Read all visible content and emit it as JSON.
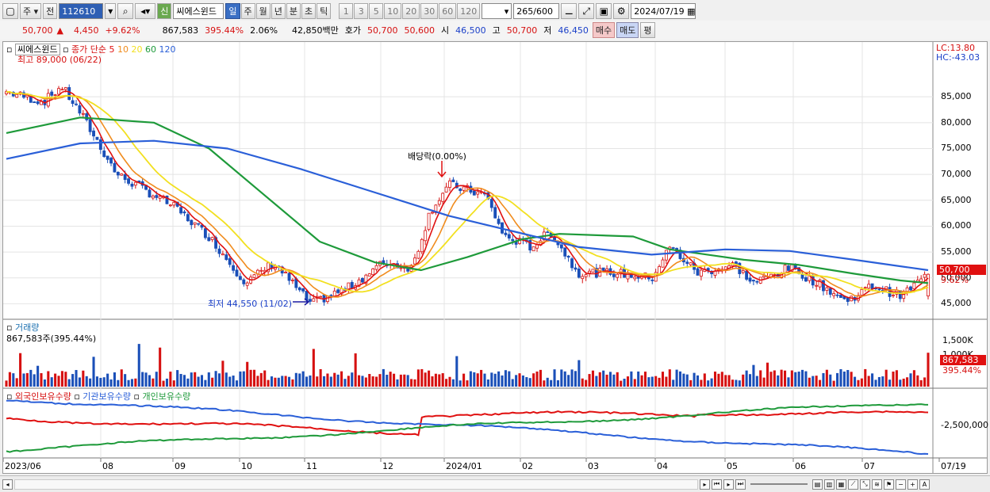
{
  "toolbar": {
    "period_type": "주",
    "prev_label": "전",
    "stock_code": "112610",
    "new_label": "신",
    "stock_name": "씨에스윈드",
    "timeframes": [
      "일",
      "주",
      "월",
      "년",
      "분",
      "초",
      "틱"
    ],
    "selected_timeframe": "일",
    "intervals": [
      "1",
      "3",
      "5",
      "10",
      "20",
      "30",
      "60",
      "120"
    ],
    "count": "265",
    "count_total": "/600",
    "date": "2024/07/19"
  },
  "quote": {
    "price": "50,700",
    "change": "4,450",
    "change_pct": "+9.62%",
    "volume": "867,583",
    "volume_ratio": "395.44%",
    "turnover_pct": "2.06%",
    "amount": "42,850백만",
    "ask_label": "호가",
    "ask": "50,700",
    "bid": "50,600",
    "open_label": "시",
    "open": "46,500",
    "high_label": "고",
    "high": "50,700",
    "low_label": "저",
    "low": "46,450",
    "buy_label": "매수",
    "sell_label": "매도",
    "eval_label": "평"
  },
  "price_pane": {
    "legend_name": "씨에스윈드",
    "ma_title": "종가 단순",
    "ma_periods": [
      "5",
      "10",
      "20",
      "60",
      "120"
    ],
    "high_note": "최고 89,000 (06/22)",
    "low_note": "최저 44,550 (11/02)",
    "dividend_note": "배당락(0.00%)",
    "lc": "LC:13.80",
    "hc": "HC:-43.03",
    "y_ticks": [
      "85,000",
      "80,000",
      "75,000",
      "70,000",
      "65,000",
      "60,000",
      "55,000",
      "50,000",
      "45,000"
    ],
    "last_price": "50,700",
    "last_pct": "9.62%"
  },
  "volume_pane": {
    "title": "거래량",
    "value": "867,583주(395.44%)",
    "ticks": [
      "1,500K",
      "1,000K"
    ],
    "last": "867,583",
    "last_pct": "395.44%"
  },
  "holder_pane": {
    "legend": [
      "외국인보유수량",
      "기관보유수량",
      "개인보유수량"
    ],
    "tick": "-2,500,000"
  },
  "x_axis": [
    "2023/06",
    "08",
    "09",
    "10",
    "11",
    "12",
    "2024/01",
    "02",
    "03",
    "04",
    "05",
    "06",
    "07",
    "07/19"
  ],
  "colors": {
    "ma5": "#e01010",
    "ma10": "#f08c1e",
    "ma20": "#f2e020",
    "ma60": "#1e9a3a",
    "ma120": "#2a5fd8",
    "up": "#d61010",
    "down": "#1a4fb8"
  },
  "chart_data": {
    "type": "line",
    "y_range": [
      42000,
      91000
    ],
    "anchors": [
      {
        "x": 0.0,
        "close": 86000
      },
      {
        "x": 0.04,
        "close": 84000
      },
      {
        "x": 0.06,
        "close": 87000
      },
      {
        "x": 0.08,
        "close": 82000
      },
      {
        "x": 0.12,
        "close": 70000
      },
      {
        "x": 0.18,
        "close": 64000
      },
      {
        "x": 0.22,
        "close": 58000
      },
      {
        "x": 0.26,
        "close": 49000
      },
      {
        "x": 0.29,
        "close": 53000
      },
      {
        "x": 0.33,
        "close": 45000
      },
      {
        "x": 0.37,
        "close": 48000
      },
      {
        "x": 0.41,
        "close": 53000
      },
      {
        "x": 0.44,
        "close": 52000
      },
      {
        "x": 0.46,
        "close": 63000
      },
      {
        "x": 0.48,
        "close": 68000
      },
      {
        "x": 0.52,
        "close": 66000
      },
      {
        "x": 0.54,
        "close": 58000
      },
      {
        "x": 0.57,
        "close": 56000
      },
      {
        "x": 0.59,
        "close": 59000
      },
      {
        "x": 0.62,
        "close": 51000
      },
      {
        "x": 0.66,
        "close": 51000
      },
      {
        "x": 0.7,
        "close": 50000
      },
      {
        "x": 0.72,
        "close": 56000
      },
      {
        "x": 0.75,
        "close": 51000
      },
      {
        "x": 0.79,
        "close": 52500
      },
      {
        "x": 0.81,
        "close": 49000
      },
      {
        "x": 0.85,
        "close": 52000
      },
      {
        "x": 0.89,
        "close": 48000
      },
      {
        "x": 0.91,
        "close": 45500
      },
      {
        "x": 0.94,
        "close": 48500
      },
      {
        "x": 0.97,
        "close": 46500
      },
      {
        "x": 1.0,
        "close": 50700
      }
    ],
    "ma60": [
      [
        0,
        78000
      ],
      [
        0.08,
        81000
      ],
      [
        0.16,
        80000
      ],
      [
        0.22,
        75000
      ],
      [
        0.28,
        66000
      ],
      [
        0.34,
        57000
      ],
      [
        0.4,
        53000
      ],
      [
        0.45,
        51500
      ],
      [
        0.5,
        54000
      ],
      [
        0.56,
        57500
      ],
      [
        0.6,
        58500
      ],
      [
        0.68,
        58000
      ],
      [
        0.72,
        55500
      ],
      [
        0.8,
        53500
      ],
      [
        0.86,
        52500
      ],
      [
        0.92,
        50800
      ],
      [
        0.97,
        49500
      ],
      [
        1.0,
        49000
      ]
    ],
    "ma120": [
      [
        0,
        73000
      ],
      [
        0.08,
        76000
      ],
      [
        0.16,
        76500
      ],
      [
        0.24,
        75000
      ],
      [
        0.32,
        71000
      ],
      [
        0.4,
        66500
      ],
      [
        0.48,
        62000
      ],
      [
        0.55,
        59000
      ],
      [
        0.62,
        56000
      ],
      [
        0.7,
        54500
      ],
      [
        0.78,
        55500
      ],
      [
        0.85,
        55200
      ],
      [
        0.92,
        53500
      ],
      [
        1.0,
        51500
      ]
    ]
  }
}
